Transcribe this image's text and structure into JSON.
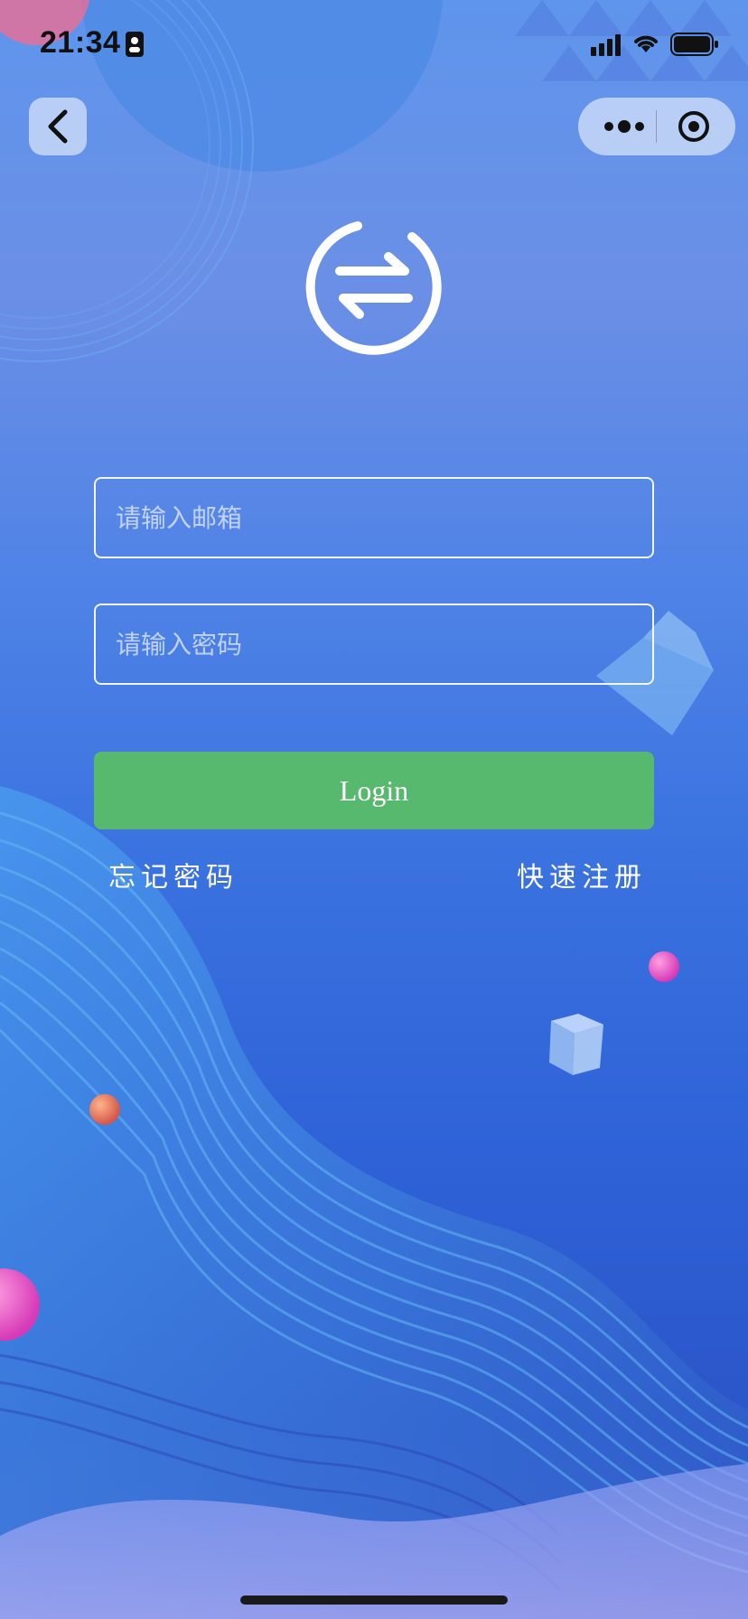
{
  "status_bar": {
    "time": "21:34"
  },
  "nav": {
    "back_icon": "chevron-left-icon",
    "more_icon": "more-dots-icon",
    "target_icon": "target-circle-icon"
  },
  "logo": {
    "icon": "swap-arrows-icon"
  },
  "form": {
    "email_placeholder": "请输入邮箱",
    "email_value": "",
    "password_placeholder": "请输入密码",
    "password_value": "",
    "login_label": "Login",
    "forgot_label": "忘记密码",
    "register_label": "快速注册"
  },
  "colors": {
    "accent_green": "#56b96e",
    "background_blue": "#3b73e0"
  }
}
